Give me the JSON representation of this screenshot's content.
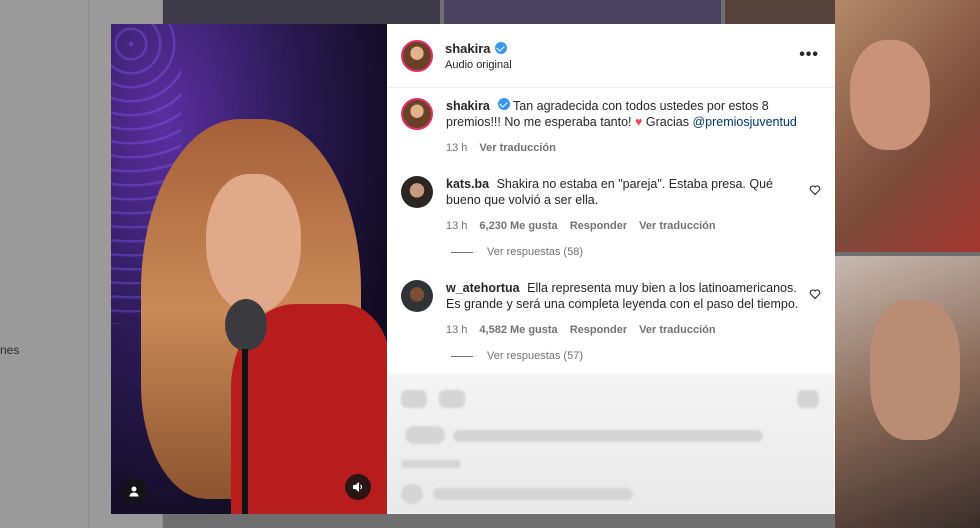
{
  "background": {
    "sidebar_text": "nes"
  },
  "post": {
    "username": "shakira",
    "audio": "Audio original",
    "more": "•••"
  },
  "caption": {
    "username": "shakira",
    "text_before_heart": "Tan agradecida con todos ustedes por estos 8 premios!!! No me esperaba tanto!",
    "heart": "♥",
    "text_after_heart": "Gracias",
    "mention": "@premiosjuventud",
    "time": "13 h",
    "translate": "Ver traducción"
  },
  "comments": [
    {
      "username": "kats.ba",
      "text": "Shakira no estaba en \"pareja\". Estaba presa. Qué bueno que volvió a ser ella.",
      "time": "13 h",
      "likes": "6,230 Me gusta",
      "reply": "Responder",
      "translate": "Ver traducción",
      "replies": "Ver respuestas (58)"
    },
    {
      "username": "w_atehortua",
      "text": "Ella representa muy bien a los latinoamericanos. Es grande y será una completa leyenda con el paso del tiempo.",
      "time": "13 h",
      "likes": "4,582 Me gusta",
      "reply": "Responder",
      "translate": "Ver traducción",
      "replies": "Ver respuestas (57)"
    }
  ],
  "colors": {
    "verified": "#3897f0",
    "mention": "#00376b",
    "heart": "#ed4956",
    "meta": "#737373"
  }
}
